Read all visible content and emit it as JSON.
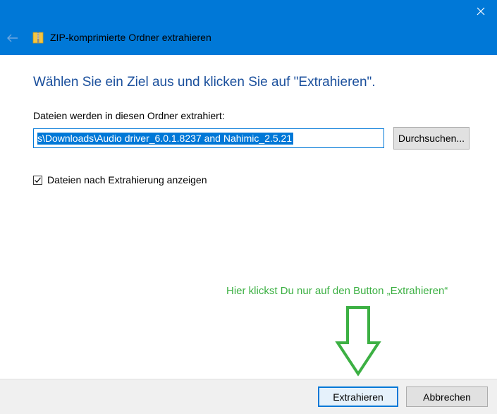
{
  "window": {
    "title": "ZIP-komprimierte Ordner extrahieren",
    "accent_color": "#0078d7",
    "icons": [
      "back-arrow-icon",
      "zip-folder-icon",
      "close-icon"
    ]
  },
  "content": {
    "heading": "Wählen Sie ein Ziel aus und klicken Sie auf \"Extrahieren\".",
    "field_label": "Dateien werden in diesen Ordner extrahiert:",
    "path_value": "s\\Downloads\\Audio driver_6.0.1.8237 and Nahimic_2.5.21",
    "browse_label": "Durchsuchen...",
    "checkbox_label": "Dateien nach Extrahierung anzeigen",
    "checkbox_checked": true
  },
  "annotation": {
    "text": "Hier klickst Du nur auf den Button „Extrahieren“",
    "color": "#3cb043"
  },
  "footer": {
    "extract_label": "Extrahieren",
    "cancel_label": "Abbrechen"
  }
}
